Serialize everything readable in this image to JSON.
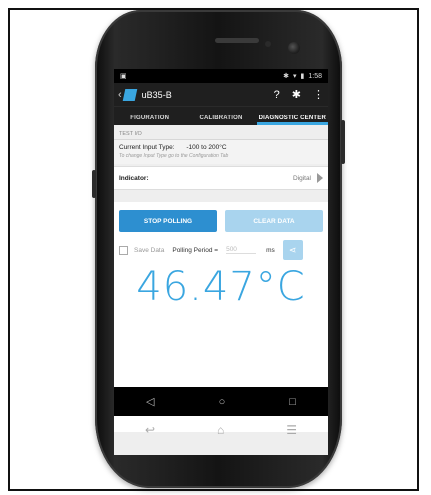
{
  "statusbar": {
    "left_icon": "▣",
    "bt_icon": "✱",
    "wifi_icon": "▾",
    "time": "1:58"
  },
  "app": {
    "title": "uB35-B",
    "back_glyph": "‹",
    "help_glyph": "?",
    "settings_glyph": "✱",
    "overflow_glyph": "⋮",
    "accent": "#3aa6e0"
  },
  "tabs": [
    {
      "label": "FIGURATION"
    },
    {
      "label": "CALIBRATION"
    },
    {
      "label": "DIAGNOSTIC CENTER"
    }
  ],
  "test_io": {
    "header": "TEST I/O",
    "input_type_label": "Current Input Type:",
    "input_type_value": "-100 to 200°C",
    "hint": "To change Input Type go to the Configuration Tab"
  },
  "indicator": {
    "label": "Indicator:",
    "value": "Digital"
  },
  "buttons": {
    "stop": "STOP POLLING",
    "clear": "CLEAR DATA"
  },
  "options": {
    "save_data": "Save Data",
    "polling_label": "Polling Period =",
    "polling_value": "500",
    "unit": "ms"
  },
  "reading": "46.47°C",
  "nav": {
    "back": "◁",
    "home": "○",
    "recents": "□"
  },
  "hw_keys": {
    "back": "↩",
    "home": "⌂",
    "menu": "☰"
  }
}
